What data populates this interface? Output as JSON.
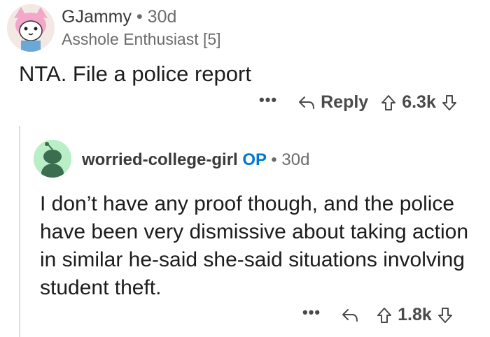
{
  "comment": {
    "username": "GJammy",
    "separator": "•",
    "age": "30d",
    "flair": "Asshole Enthusiast [5]",
    "body": "NTA. File a police report",
    "more_label": "•••",
    "reply_label": "Reply",
    "score": "6.3k",
    "avatar_icon": "cat-avatar-icon"
  },
  "reply": {
    "username": "worried-college-girl",
    "op_badge": "OP",
    "separator": "•",
    "age": "30d",
    "body": "I don’t have any proof though, and the police have been very dismissive about taking action in similar he-said she-said situations involving student theft.",
    "more_label": "•••",
    "score": "1.8k",
    "avatar_icon": "snoo-avatar-icon"
  },
  "colors": {
    "op_badge": "#0079d3",
    "avatar2_bg": "#b9eec7",
    "avatar2_figure": "#3b6e4f"
  }
}
